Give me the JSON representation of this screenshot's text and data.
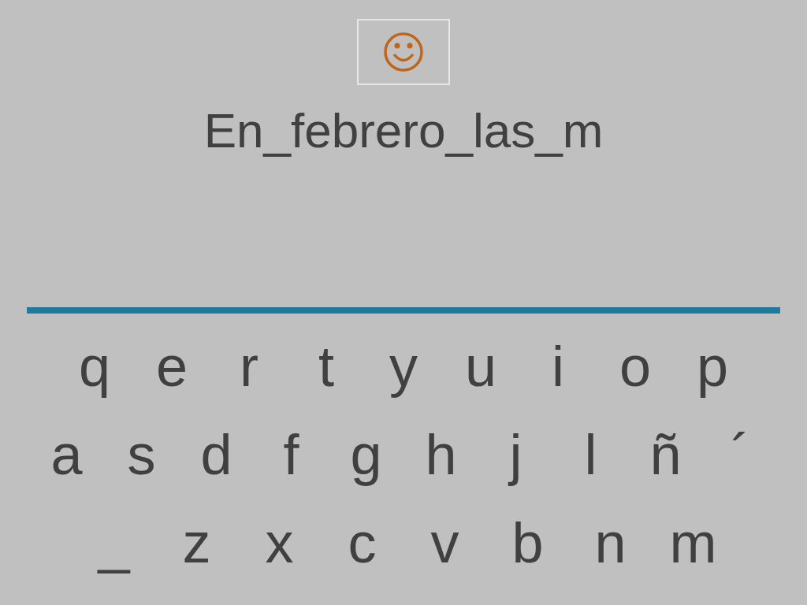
{
  "sentence": "En_febrero_las_m",
  "keyboard": {
    "rows": [
      {
        "keys": [
          "q",
          "e",
          "r",
          "t",
          "y",
          "u",
          "i",
          "o",
          "p"
        ]
      },
      {
        "keys": [
          "a",
          "s",
          "d",
          "f",
          "g",
          "h",
          "j",
          "l",
          "ñ",
          "´"
        ]
      },
      {
        "keys": [
          "_",
          "z",
          "x",
          "c",
          "v",
          "b",
          "n",
          "m"
        ]
      }
    ]
  }
}
